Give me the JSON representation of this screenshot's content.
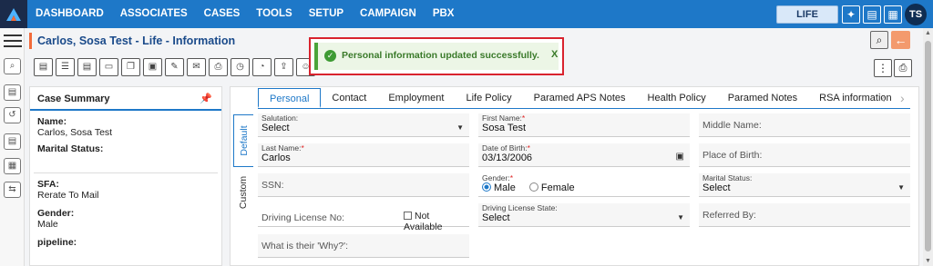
{
  "nav": {
    "items": [
      "DASHBOARD",
      "ASSOCIATES",
      "CASES",
      "TOOLS",
      "SETUP",
      "CAMPAIGN",
      "PBX"
    ],
    "life_label": "LIFE",
    "avatar_initials": "TS"
  },
  "page": {
    "title": "Carlos, Sosa Test - Life - Information"
  },
  "toast": {
    "message": "Personal information updated successfully.",
    "close_label": "X"
  },
  "summary": {
    "heading": "Case Summary",
    "name_label": "Name:",
    "name_value": "Carlos, Sosa Test",
    "marital_label": "Marital Status:",
    "marital_value": "",
    "sfa_label": "SFA:",
    "sfa_value": "Rerate To Mail",
    "gender_label": "Gender:",
    "gender_value": "Male",
    "pipeline_label": "pipeline:"
  },
  "tabs": [
    "Personal",
    "Contact",
    "Employment",
    "Life Policy",
    "Paramed APS Notes",
    "Health Policy",
    "Paramed Notes",
    "RSA information"
  ],
  "vtabs": [
    "Default",
    "Custom"
  ],
  "form": {
    "salutation_label": "Salutation:",
    "salutation_value": "Select",
    "first_name_label": "First Name:",
    "first_name_value": "Sosa Test",
    "middle_name_ph": "Middle Name:",
    "last_name_label": "Last Name:",
    "last_name_value": "Carlos",
    "dob_label": "Date of Birth:",
    "dob_value": "03/13/2006",
    "place_birth_ph": "Place of Birth:",
    "ssn_ph": "SSN:",
    "gender_label": "Gender:",
    "gender_male": "Male",
    "gender_female": "Female",
    "marital_label": "Marital Status:",
    "marital_value": "Select",
    "dl_ph": "Driving License No:",
    "not_available": "Not Available",
    "dl_state_label": "Driving License State:",
    "dl_state_value": "Select",
    "referred_ph": "Referred By:",
    "why_ph": "What is their 'Why?':"
  },
  "colors": {
    "nav_bg": "#1e78c8",
    "accent": "#f26b3a",
    "success": "#3e9b33",
    "toast_border": "#d9232e"
  }
}
